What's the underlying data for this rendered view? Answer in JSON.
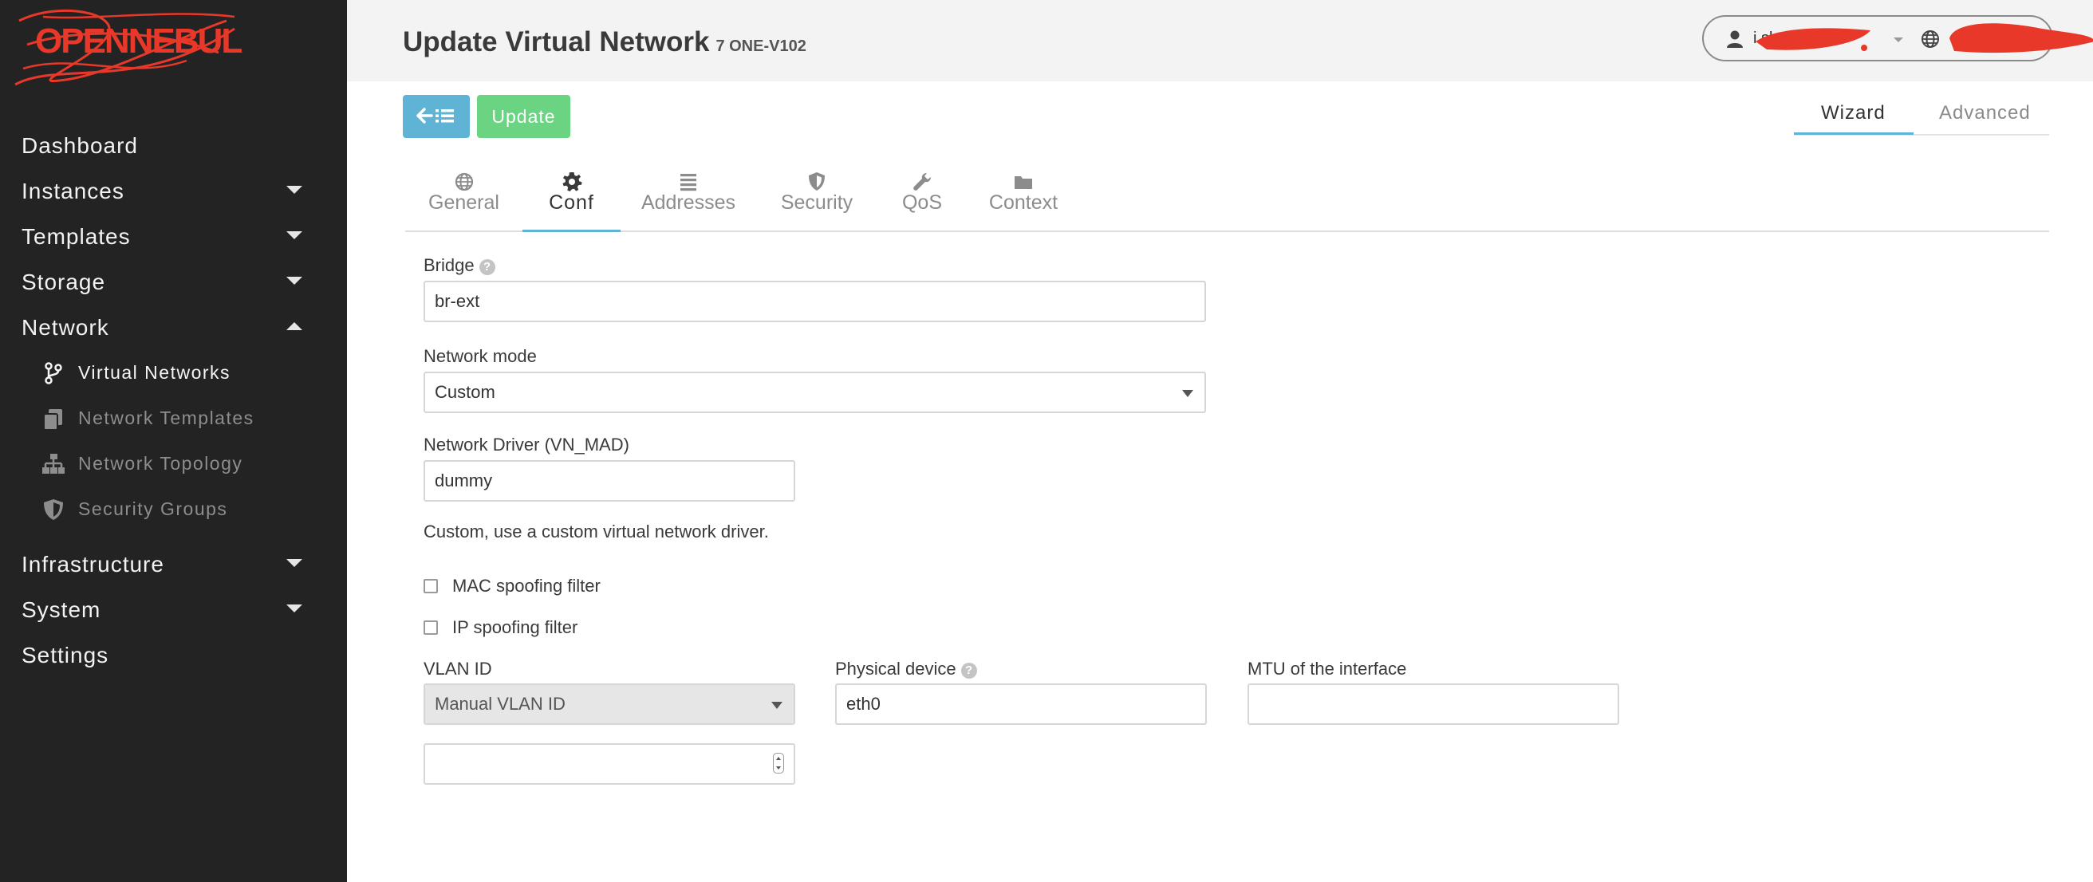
{
  "sidebar": {
    "logo_text": "OPENNEBULA",
    "items": [
      {
        "label": "Dashboard",
        "has_caret": false
      },
      {
        "label": "Instances",
        "has_caret": true
      },
      {
        "label": "Templates",
        "has_caret": true
      },
      {
        "label": "Storage",
        "has_caret": true
      },
      {
        "label": "Network",
        "has_caret": true,
        "expanded": true
      }
    ],
    "network_subitems": [
      {
        "label": "Virtual Networks",
        "icon": "code-fork-icon",
        "active": true
      },
      {
        "label": "Network Templates",
        "icon": "copy-icon",
        "active": false
      },
      {
        "label": "Network Topology",
        "icon": "sitemap-icon",
        "active": false
      },
      {
        "label": "Security Groups",
        "icon": "shield-icon",
        "active": false
      }
    ],
    "items_after": [
      {
        "label": "Infrastructure",
        "has_caret": true
      },
      {
        "label": "System",
        "has_caret": true
      },
      {
        "label": "Settings",
        "has_caret": false
      }
    ]
  },
  "header": {
    "title": "Update Virtual Network",
    "subtitle": "7 ONE-V102",
    "user_name_visible": "i sl",
    "zone_name_visible": ".."
  },
  "toolbar": {
    "back_icon": "arrow-left-list-icon",
    "update_label": "Update",
    "mode_tabs": [
      "Wizard",
      "Advanced"
    ],
    "active_mode": "Wizard"
  },
  "tabs": [
    {
      "label": "General",
      "icon": "globe-icon"
    },
    {
      "label": "Conf",
      "icon": "gear-icon",
      "active": true
    },
    {
      "label": "Addresses",
      "icon": "list-icon"
    },
    {
      "label": "Security",
      "icon": "shield-icon"
    },
    {
      "label": "QoS",
      "icon": "wrench-icon"
    },
    {
      "label": "Context",
      "icon": "folder-icon"
    }
  ],
  "form": {
    "bridge_label": "Bridge",
    "bridge_value": "br-ext",
    "network_mode_label": "Network mode",
    "network_mode_value": "Custom",
    "driver_label": "Network Driver (VN_MAD)",
    "driver_value": "dummy",
    "driver_note": "Custom, use a custom virtual network driver.",
    "mac_spoofing_label": "MAC spoofing filter",
    "ip_spoofing_label": "IP spoofing filter",
    "vlan_label": "VLAN ID",
    "vlan_select_value": "Manual VLAN ID",
    "vlan_input_value": "",
    "phydev_label": "Physical device",
    "phydev_value": "eth0",
    "mtu_label": "MTU of the interface",
    "mtu_value": ""
  },
  "colors": {
    "sidebar_bg": "#232323",
    "accent_blue": "#5fb4d6",
    "update_green": "#6ad483",
    "redaction_red": "#e8382a"
  }
}
